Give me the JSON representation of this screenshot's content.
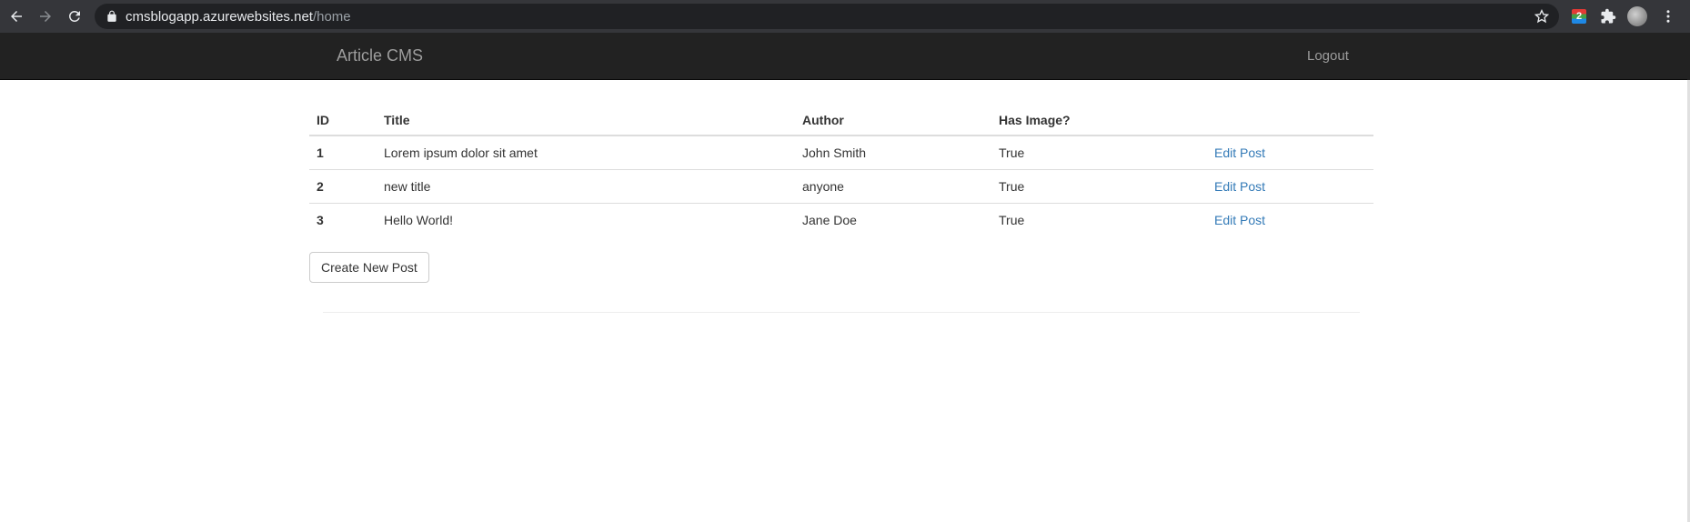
{
  "browser": {
    "url_host": "cmsblogapp.azurewebsites.net",
    "url_path": "/home",
    "extension_badge": "2"
  },
  "navbar": {
    "brand": "Article CMS",
    "logout_label": "Logout",
    "background_color": "#222222"
  },
  "table": {
    "headers": [
      "ID",
      "Title",
      "Author",
      "Has Image?",
      ""
    ],
    "rows": [
      {
        "id": "1",
        "title": "Lorem ipsum dolor sit amet",
        "author": "John Smith",
        "has_image": "True",
        "action": "Edit Post"
      },
      {
        "id": "2",
        "title": "new title",
        "author": "anyone",
        "has_image": "True",
        "action": "Edit Post"
      },
      {
        "id": "3",
        "title": "Hello World!",
        "author": "Jane Doe",
        "has_image": "True",
        "action": "Edit Post"
      }
    ],
    "link_color": "#337ab7"
  },
  "actions": {
    "create_label": "Create New Post"
  }
}
